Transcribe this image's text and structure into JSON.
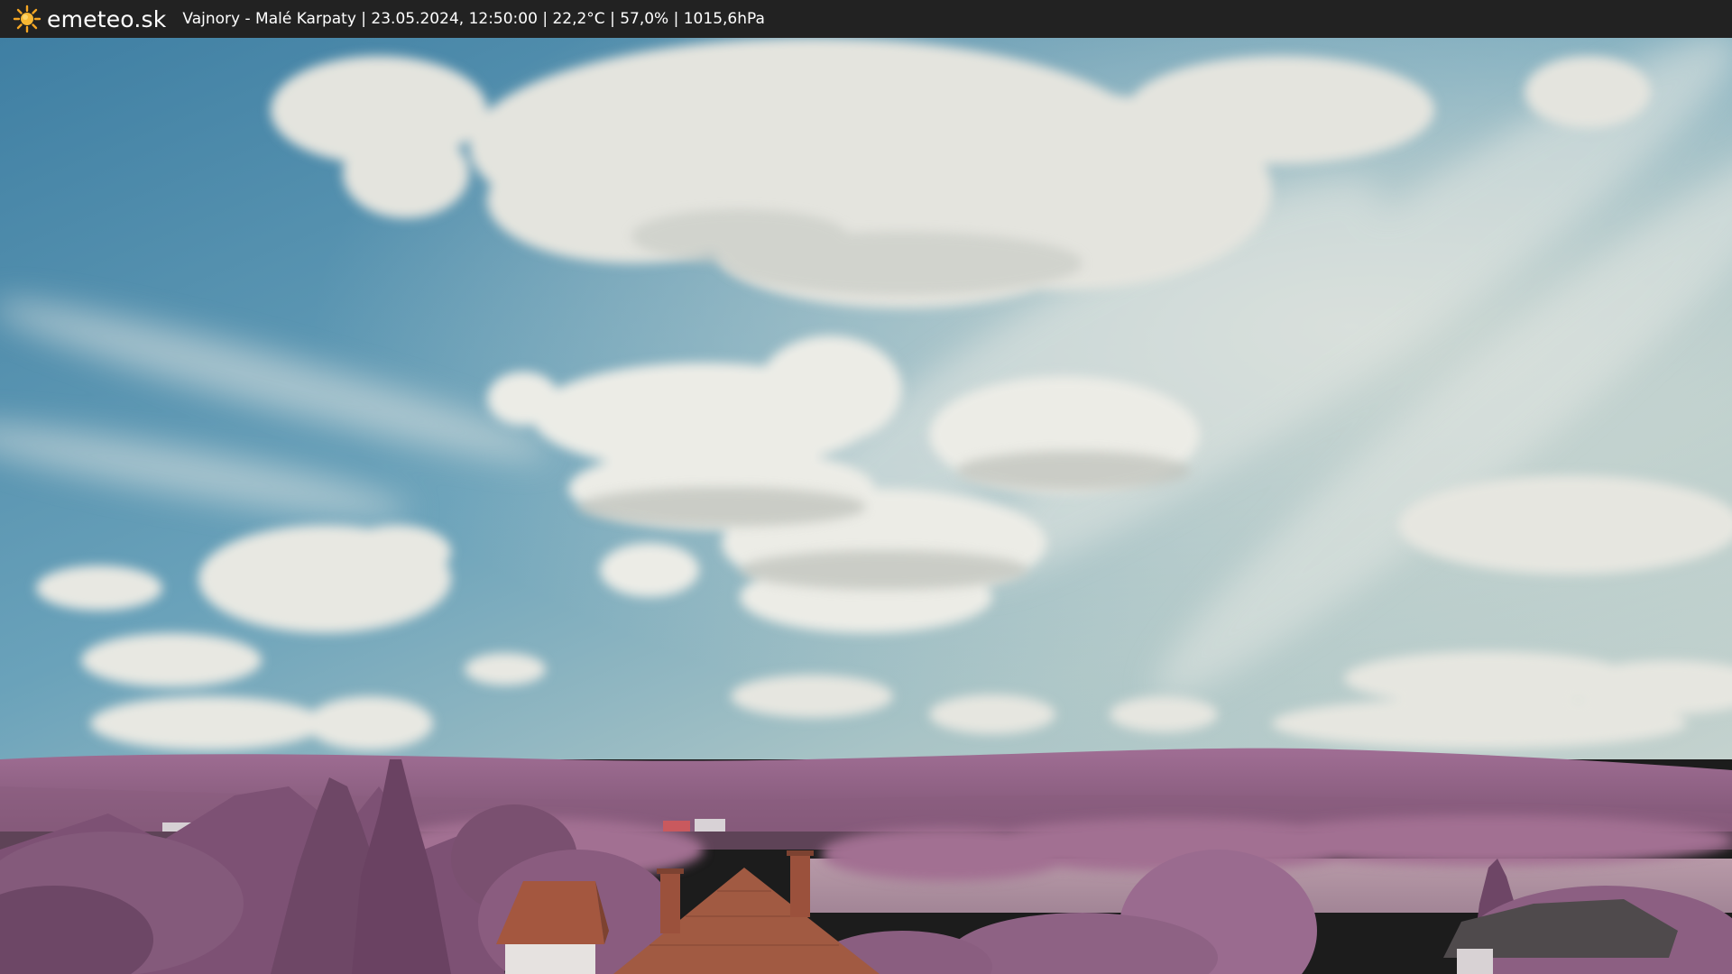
{
  "header": {
    "brand": "emeteo.sk",
    "logo_icon": "sun-icon",
    "caption": "Vajnory - Malé Karpaty | 23.05.2024, 12:50:00 | 22,2°C | 57,0% | 1015,6hPa",
    "background": "#222222",
    "logo_color": "#f5a623"
  },
  "webcam": {
    "sky_color": "#4f8fb0",
    "cloud_color": "#e6e6e0",
    "vegetation_color": "#9a6a8e",
    "roof_color": "#a4573f"
  }
}
